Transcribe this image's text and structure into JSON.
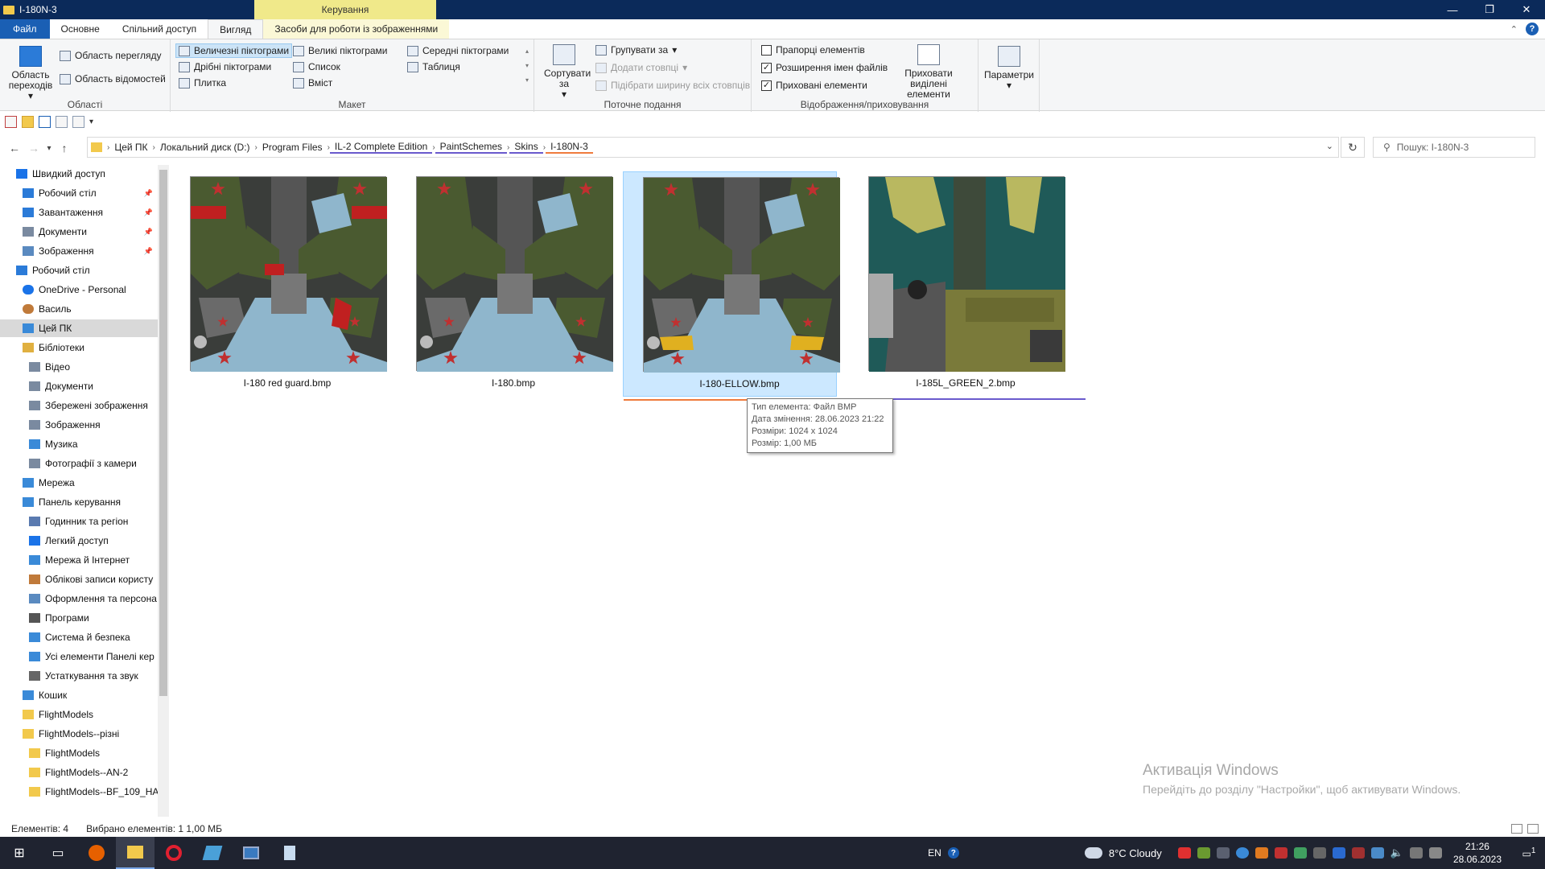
{
  "window": {
    "title": "I-180N-3",
    "context_tab": "Керування",
    "controls": [
      "—",
      "❐",
      "✕"
    ]
  },
  "tabs": [
    "Файл",
    "Основне",
    "Спільний доступ",
    "Вигляд",
    "Засоби для роботи із зображеннями"
  ],
  "ribbon": {
    "areas": {
      "nav_pane": "Область переходів",
      "preview_pane": "Область перегляду",
      "details_pane": "Область відомостей",
      "label": "Області"
    },
    "layout": {
      "items": [
        "Величезні піктограми",
        "Великі піктограми",
        "Середні піктограми",
        "Дрібні піктограми",
        "Список",
        "Таблиця",
        "Плитка",
        "Вміст"
      ],
      "label": "Макет"
    },
    "current_view": {
      "sort": "Сортувати за",
      "group": "Групувати за",
      "add_columns": "Додати стовпці",
      "fit_columns": "Підібрати ширину всіх стовпців",
      "label": "Поточне подання"
    },
    "show_hide": {
      "checkboxes": "Прапорці елементів",
      "extensions": "Розширення імен файлів",
      "hidden": "Приховані елементи",
      "hide_selected": "Приховати виділені елементи",
      "label": "Відображення/приховування"
    },
    "options": "Параметри"
  },
  "breadcrumb": [
    "Цей ПК",
    "Локальний диск (D:)",
    "Program Files",
    "IL-2 Complete Edition",
    "PaintSchemes",
    "Skins",
    "I-180N-3"
  ],
  "search_placeholder": "Пошук: I-180N-3",
  "sidebar": [
    {
      "label": "Швидкий доступ",
      "level": 0,
      "icon": "star-icon",
      "color": "#1a73e8"
    },
    {
      "label": "Робочий стіл",
      "level": 1,
      "icon": "desktop-icon",
      "color": "#2b7bd8",
      "pin": true
    },
    {
      "label": "Завантаження",
      "level": 1,
      "icon": "download-icon",
      "color": "#2b7bd8",
      "pin": true
    },
    {
      "label": "Документи",
      "level": 1,
      "icon": "document-icon",
      "color": "#7a8aa0",
      "pin": true
    },
    {
      "label": "Зображення",
      "level": 1,
      "icon": "picture-icon",
      "color": "#5a8ac0",
      "pin": true
    },
    {
      "label": "Робочий стіл",
      "level": 0,
      "icon": "desktop-icon",
      "color": "#2b7bd8"
    },
    {
      "label": "OneDrive - Personal",
      "level": 1,
      "icon": "cloud-icon",
      "color": "#1a73e8"
    },
    {
      "label": "Василь",
      "level": 1,
      "icon": "user-icon",
      "color": "#c07a3a"
    },
    {
      "label": "Цей ПК",
      "level": 1,
      "icon": "computer-icon",
      "color": "#3a8ad8",
      "selected": true
    },
    {
      "label": "Бібліотеки",
      "level": 1,
      "icon": "library-icon",
      "color": "#e0b040"
    },
    {
      "label": "Відео",
      "level": 2,
      "icon": "video-icon",
      "color": "#7a8aa0"
    },
    {
      "label": "Документи",
      "level": 2,
      "icon": "document-icon",
      "color": "#7a8aa0"
    },
    {
      "label": "Збережені зображення",
      "level": 2,
      "icon": "picture-icon",
      "color": "#7a8aa0"
    },
    {
      "label": "Зображення",
      "level": 2,
      "icon": "picture-icon",
      "color": "#7a8aa0"
    },
    {
      "label": "Музика",
      "level": 2,
      "icon": "music-icon",
      "color": "#3a8ad8"
    },
    {
      "label": "Фотографії з камери",
      "level": 2,
      "icon": "camera-icon",
      "color": "#7a8aa0"
    },
    {
      "label": "Мережа",
      "level": 1,
      "icon": "network-icon",
      "color": "#3a8ad8"
    },
    {
      "label": "Панель керування",
      "level": 1,
      "icon": "control-panel-icon",
      "color": "#3a8ad8"
    },
    {
      "label": "Годинник та регіон",
      "level": 2,
      "icon": "clock-icon",
      "color": "#5a7ab0"
    },
    {
      "label": "Легкий доступ",
      "level": 2,
      "icon": "accessibility-icon",
      "color": "#1a73e8"
    },
    {
      "label": "Мережа й Інтернет",
      "level": 2,
      "icon": "globe-icon",
      "color": "#3a8ad8"
    },
    {
      "label": "Облікові записи користу",
      "level": 2,
      "icon": "users-icon",
      "color": "#c07a3a"
    },
    {
      "label": "Оформлення та персона",
      "level": 2,
      "icon": "palette-icon",
      "color": "#5a8ac0"
    },
    {
      "label": "Програми",
      "level": 2,
      "icon": "programs-icon",
      "color": "#555555"
    },
    {
      "label": "Система й безпека",
      "level": 2,
      "icon": "shield-icon",
      "color": "#3a8ad8"
    },
    {
      "label": "Усі елементи Панелі кер",
      "level": 2,
      "icon": "control-panel-icon",
      "color": "#3a8ad8"
    },
    {
      "label": "Устаткування та звук",
      "level": 2,
      "icon": "printer-icon",
      "color": "#666666"
    },
    {
      "label": "Кошик",
      "level": 1,
      "icon": "recycle-bin-icon",
      "color": "#3a8ad8"
    },
    {
      "label": "FlightModels",
      "level": 1,
      "icon": "folder-icon",
      "color": "#f2c94c"
    },
    {
      "label": "FlightModels--різні",
      "level": 1,
      "icon": "folder-icon",
      "color": "#f2c94c"
    },
    {
      "label": "FlightModels",
      "level": 2,
      "icon": "folder-icon",
      "color": "#f2c94c"
    },
    {
      "label": "FlightModels--AN-2",
      "level": 2,
      "icon": "folder-icon",
      "color": "#f2c94c"
    },
    {
      "label": "FlightModels--BF_109_HA",
      "level": 2,
      "icon": "folder-icon",
      "color": "#f2c94c"
    }
  ],
  "files": [
    {
      "name": "I-180 red guard.bmp",
      "variant": "redguard"
    },
    {
      "name": "I-180.bmp",
      "variant": "plain"
    },
    {
      "name": "I-180-ELLOW.bmp",
      "variant": "yellow",
      "selected": true
    },
    {
      "name": "I-185L_GREEN_2.bmp",
      "variant": "green"
    }
  ],
  "tooltip": {
    "type": "Тип елемента: Файл BMP",
    "modified": "Дата змінення: 28.06.2023 21:22",
    "dims": "Розміри: 1024 x 1024",
    "size": "Розмір: 1,00 МБ"
  },
  "watermark": {
    "line1": "Активація Windows",
    "line2": "Перейдіть до розділу \"Настройки\", щоб активувати Windows."
  },
  "status": {
    "count": "Елементів: 4",
    "selected": "Вибрано елементів: 1  1,00 МБ"
  },
  "taskbar": {
    "lang": "EN",
    "weather": "8°C  Cloudy",
    "time": "21:26",
    "date": "28.06.2023",
    "notifications": "1"
  }
}
